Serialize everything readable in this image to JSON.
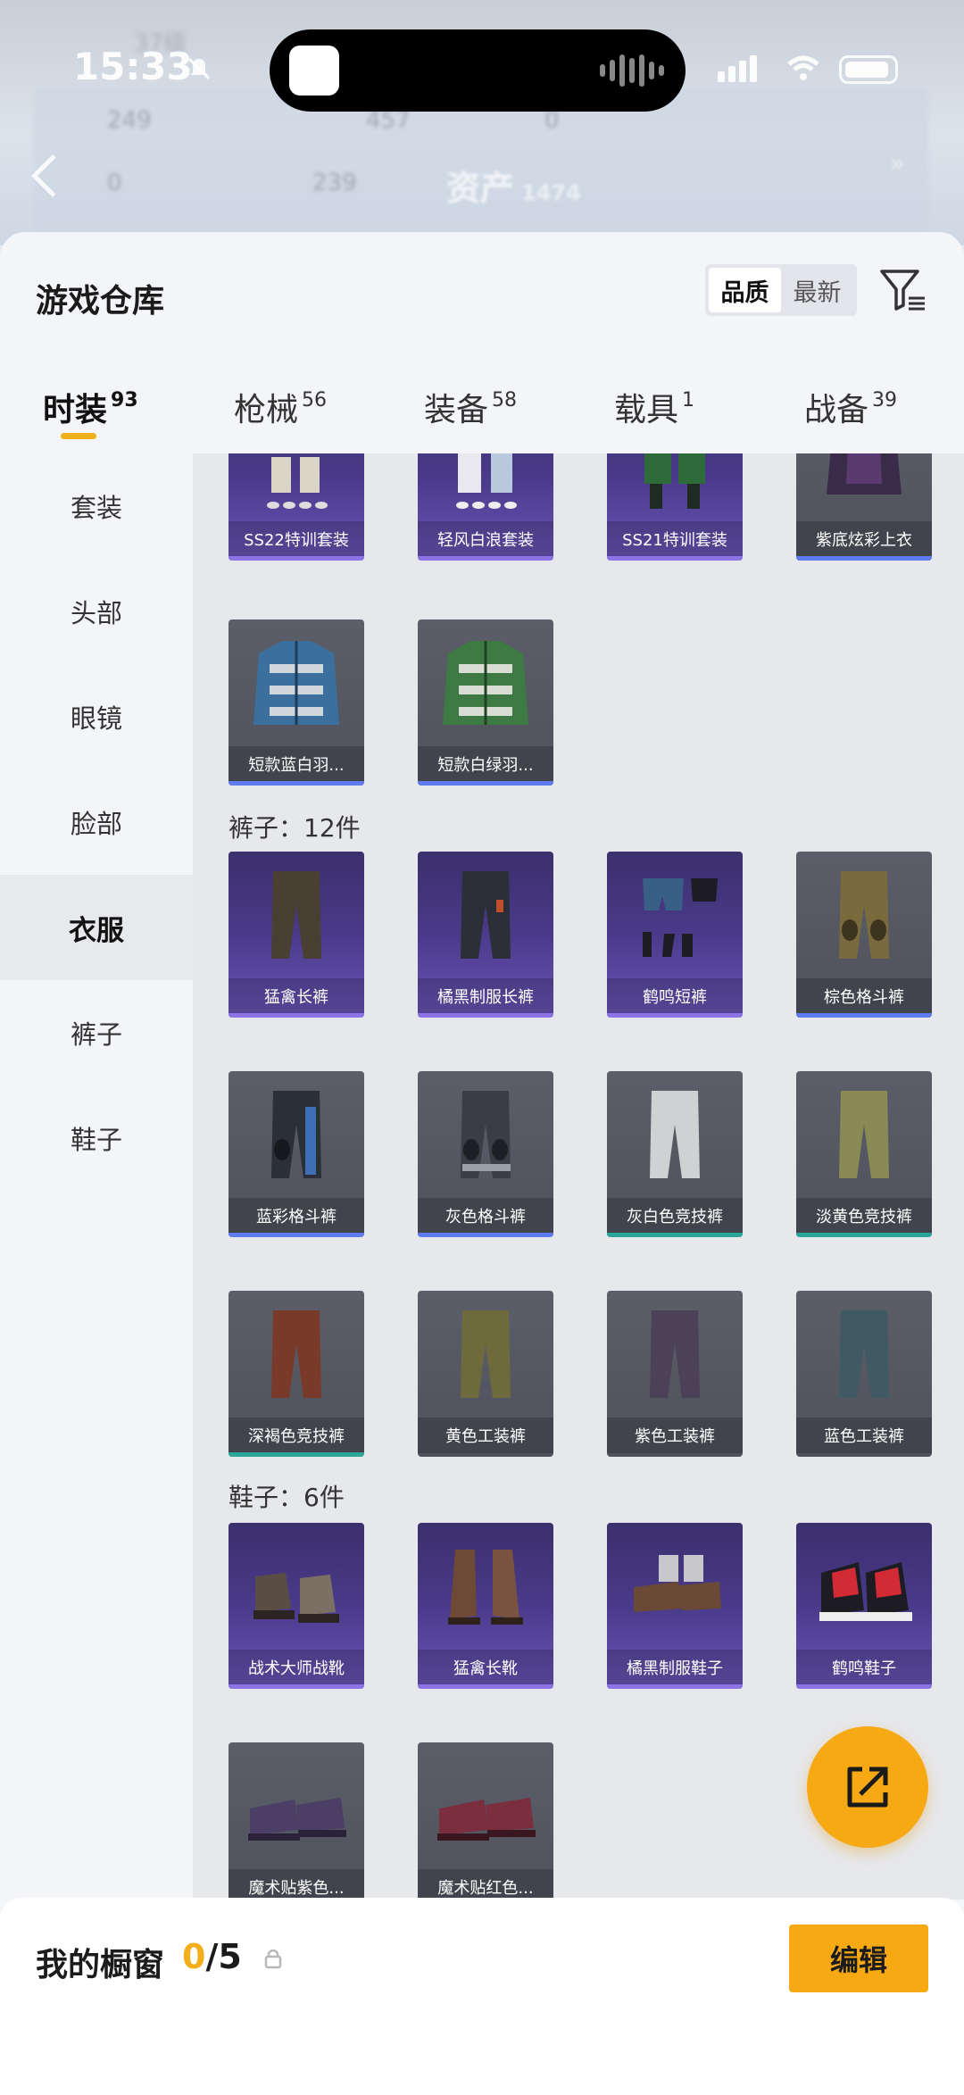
{
  "status_bar": {
    "time": "15:33"
  },
  "background": {
    "level_text": "37级",
    "stats_row1": [
      "249",
      "457",
      "0"
    ],
    "stats_row2": [
      "0",
      "239"
    ],
    "assets_title": "资产",
    "assets_value": "1474"
  },
  "header": {
    "title": "游戏仓库",
    "sort_quality": "品质",
    "sort_latest": "最新"
  },
  "tabs": [
    {
      "label": "时装",
      "count": "93"
    },
    {
      "label": "枪械",
      "count": "56"
    },
    {
      "label": "装备",
      "count": "58"
    },
    {
      "label": "载具",
      "count": "1"
    },
    {
      "label": "战备",
      "count": "39"
    }
  ],
  "sidebar": {
    "items": [
      {
        "label": "套装"
      },
      {
        "label": "头部"
      },
      {
        "label": "眼镜"
      },
      {
        "label": "脸部"
      },
      {
        "label": "衣服"
      },
      {
        "label": "裤子"
      },
      {
        "label": "鞋子"
      }
    ]
  },
  "content": {
    "row_top": [
      "SS22特训套装",
      "轻风白浪套装",
      "SS21特训套装",
      "紫底炫彩上衣"
    ],
    "row_coats": [
      "短款蓝白羽...",
      "短款白绿羽..."
    ],
    "pants_section": "裤子：12件",
    "pants": [
      "猛禽长裤",
      "橘黑制服长裤",
      "鹤鸣短裤",
      "棕色格斗裤",
      "蓝彩格斗裤",
      "灰色格斗裤",
      "灰白色竞技裤",
      "淡黄色竞技裤",
      "深褐色竞技裤",
      "黄色工装裤",
      "紫色工装裤",
      "蓝色工装裤"
    ],
    "shoes_section": "鞋子：6件",
    "shoes": [
      "战术大师战靴",
      "猛禽长靴",
      "橘黑制服鞋子",
      "鹤鸣鞋子",
      "魔术贴紫色...",
      "魔术贴红色..."
    ]
  },
  "bottom_bar": {
    "title": "我的橱窗",
    "current": "0",
    "total": "/5",
    "edit_label": "编辑"
  },
  "colors": {
    "accent": "#f7a913",
    "rare_purple": "#4a3a8a",
    "common_gray": "#55585f",
    "bar_blue": "#5e7bf0",
    "bar_teal": "#2aa596"
  }
}
